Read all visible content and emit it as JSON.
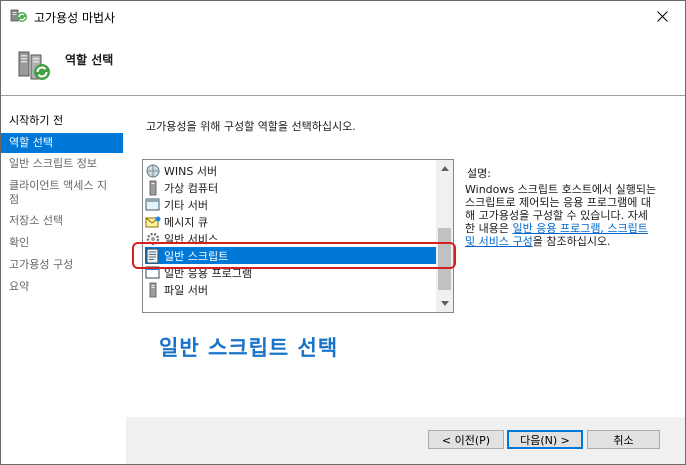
{
  "window": {
    "title": "고가용성 마법사"
  },
  "header": {
    "title": "역할 선택"
  },
  "sidebar": {
    "items": [
      {
        "label": "시작하기 전",
        "state": "normal"
      },
      {
        "label": "역할 선택",
        "state": "active"
      },
      {
        "label": "일반 스크립트 정보",
        "state": "disabled"
      },
      {
        "label": "클라이언트 액세스 지점",
        "state": "disabled"
      },
      {
        "label": "저장소 선택",
        "state": "disabled"
      },
      {
        "label": "확인",
        "state": "disabled"
      },
      {
        "label": "고가용성 구성",
        "state": "disabled"
      },
      {
        "label": "요약",
        "state": "disabled"
      }
    ]
  },
  "main": {
    "instruction": "고가용성을 위해 구성할 역할을 선택하십시오.",
    "roles": [
      {
        "label": "WINS 서버",
        "icon": "server-icon"
      },
      {
        "label": "가상 컴퓨터",
        "icon": "server-icon"
      },
      {
        "label": "기타 서버",
        "icon": "server-icon"
      },
      {
        "label": "메시지 큐",
        "icon": "envelope-icon"
      },
      {
        "label": "일반 서비스",
        "icon": "gear-icon"
      },
      {
        "label": "일반 스크립트",
        "icon": "script-icon",
        "selected": true
      },
      {
        "label": "일반 응용 프로그램",
        "icon": "application-icon"
      },
      {
        "label": "파일 서버",
        "icon": "server-icon"
      }
    ],
    "description_label": "설명:",
    "description_text": "Windows 스크립트 호스트에서 실행되는 스크립트로 제어되는 응용 프로그램에 대해 고가용성을 구성할 수 있습니다. 자세한 내용은 ",
    "description_link": "일반 응용 프로그램, 스크립트 및 서비스 구성",
    "description_suffix": "을 참조하십시오.",
    "annotation": "일반 스크립트 선택"
  },
  "buttons": {
    "back": "< 이전(P)",
    "next": "다음(N) >",
    "cancel": "취소"
  },
  "colors": {
    "accent": "#0078d7",
    "annotation": "#1a73c9",
    "highlight": "#d42020"
  }
}
